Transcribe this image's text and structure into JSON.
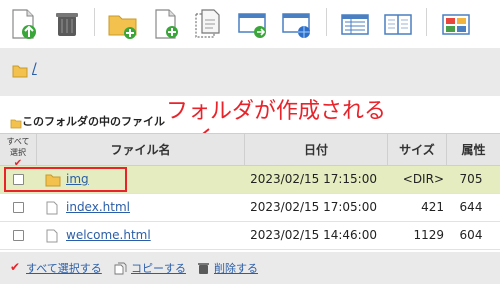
{
  "toolbar": {
    "buttons": [
      {
        "name": "upload-icon"
      },
      {
        "name": "trash-icon"
      },
      {
        "name": "new-folder-icon"
      },
      {
        "name": "new-file-icon"
      },
      {
        "name": "copy-icon"
      },
      {
        "name": "window-move-icon"
      },
      {
        "name": "window-web-icon"
      },
      {
        "name": "list-view-icon"
      },
      {
        "name": "split-view-icon"
      },
      {
        "name": "tiles-icon"
      }
    ]
  },
  "path": {
    "text": "/"
  },
  "section": {
    "title": "このフォルダの中のファイル"
  },
  "annotation": {
    "text": "フォルダが作成される"
  },
  "table": {
    "headers": {
      "select_line1": "すべて",
      "select_line2": "選択",
      "name": "ファイル名",
      "date": "日付",
      "size": "サイズ",
      "attr": "属性"
    },
    "rows": [
      {
        "type": "folder",
        "name": "img",
        "date": "2023/02/15 17:15:00",
        "size": "<DIR>",
        "attr": "705"
      },
      {
        "type": "file",
        "name": "index.html",
        "date": "2023/02/15 17:05:00",
        "size": "421",
        "attr": "644"
      },
      {
        "type": "file",
        "name": "welcome.html",
        "date": "2023/02/15 14:46:00",
        "size": "1129",
        "attr": "604"
      }
    ]
  },
  "footer": {
    "select_all": "すべて選択する",
    "copy": "コピーする",
    "delete": "削除する"
  },
  "colors": {
    "accent_red": "#e8232a",
    "link_blue": "#2b5ea8",
    "highlight_row": "#e4ecc0",
    "folder_yellow": "#f2c14e"
  }
}
